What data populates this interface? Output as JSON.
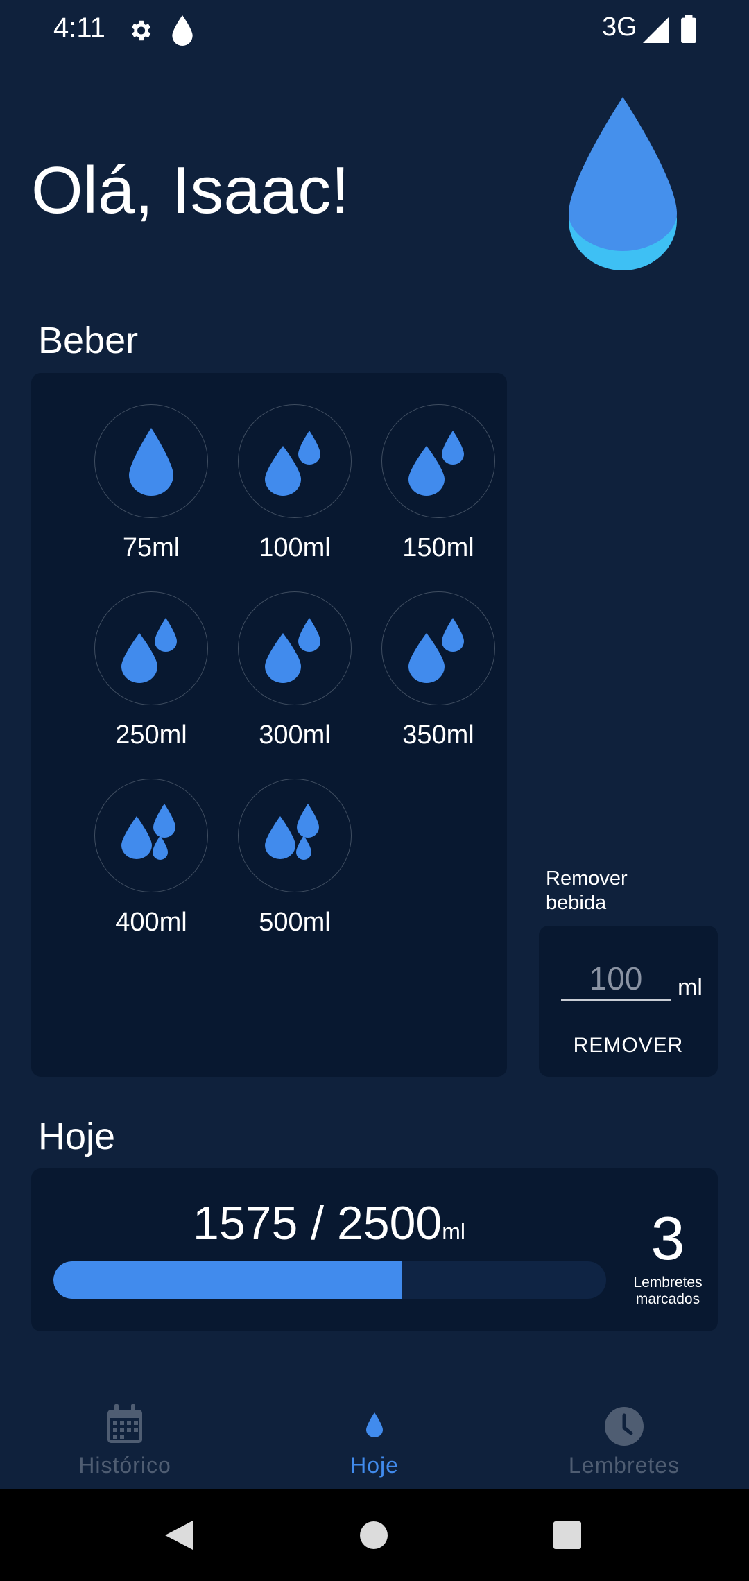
{
  "status_bar": {
    "time": "4:11",
    "network": "3G"
  },
  "greeting": "Olá, Isaac!",
  "drink": {
    "title": "Beber",
    "options": [
      {
        "label": "75ml",
        "icon": "single-drop-icon"
      },
      {
        "label": "100ml",
        "icon": "two-drops-icon"
      },
      {
        "label": "150ml",
        "icon": "two-drops-icon"
      },
      {
        "label": "250ml",
        "icon": "two-drops-icon"
      },
      {
        "label": "300ml",
        "icon": "two-drops-icon"
      },
      {
        "label": "350ml",
        "icon": "two-drops-icon"
      },
      {
        "label": "400ml",
        "icon": "three-drops-icon"
      },
      {
        "label": "500ml",
        "icon": "three-drops-icon"
      }
    ]
  },
  "remove": {
    "label": "Remover bebida",
    "placeholder": "100",
    "unit": "ml",
    "button": "REMOVER"
  },
  "today": {
    "title": "Hoje",
    "amount": "1575 / 2500",
    "unit": "ml",
    "progress_fraction": 0.63,
    "reminder_count": "3",
    "reminder_label": "Lembretes marcados"
  },
  "bottom_nav": {
    "items": [
      {
        "label": "Histórico",
        "icon": "calendar-icon",
        "active": false
      },
      {
        "label": "Hoje",
        "icon": "drop-icon",
        "active": true
      },
      {
        "label": "Lembretes",
        "icon": "clock-icon",
        "active": false
      }
    ]
  },
  "colors": {
    "background": "#0f213c",
    "card": "#081830",
    "accent": "#418bed",
    "inactive_nav": "#4f5d72"
  }
}
